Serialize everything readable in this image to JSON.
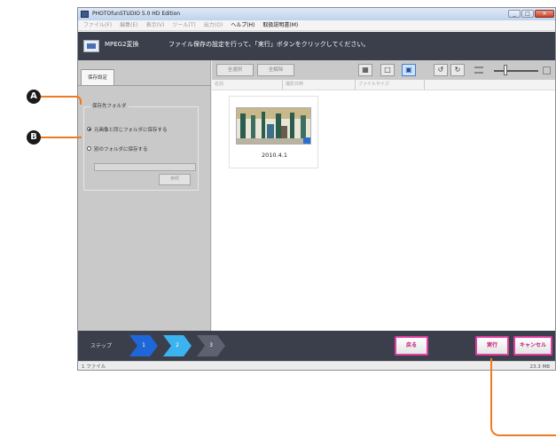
{
  "window": {
    "title": "PHOTOfunSTUDIO 5.0 HD Edition",
    "controls": [
      "_",
      "□",
      "✕"
    ]
  },
  "menu": {
    "items": [
      {
        "label": "ファイル(F)",
        "enabled": false
      },
      {
        "label": "編集(E)",
        "enabled": false
      },
      {
        "label": "表示(V)",
        "enabled": false
      },
      {
        "label": "ツール(T)",
        "enabled": false
      },
      {
        "label": "出力(O)",
        "enabled": false
      },
      {
        "label": "ヘルプ(H)",
        "enabled": true
      },
      {
        "label": "取扱説明書(M)",
        "enabled": true
      }
    ]
  },
  "header": {
    "title": "MPEG2変換",
    "message": "ファイル保存の設定を行って、「実行」ボタンをクリックしてください。"
  },
  "left_panel": {
    "tab_label": "保存設定",
    "group_label": "保存先フォルダ",
    "options": [
      {
        "label": "元画像と同じフォルダに保存する",
        "selected": true
      },
      {
        "label": "別のフォルダに保存する",
        "selected": false
      }
    ],
    "browse_label": "参照"
  },
  "toolbar": {
    "select_all": "全選択",
    "deselect_all": "全解除",
    "icons": [
      "view-mode-icon",
      "single-view-icon",
      "thumbnail-view-icon",
      "rotate-left-icon",
      "rotate-right-icon",
      "list-icon"
    ],
    "zoom_level": 0.22
  },
  "columns": [
    "名前",
    "撮影日時",
    "ファイルサイズ"
  ],
  "thumbnail": {
    "date": "2010.4.1",
    "colors": {
      "sky": "#c9b88a",
      "wall": "#e9e6d6",
      "pillar": "#2a5d4d",
      "people": "#3b6f8a"
    }
  },
  "steps": {
    "label": "ステップ",
    "items": [
      {
        "label": "1",
        "color": "#1f66d8"
      },
      {
        "label": "2",
        "color": "#3ab3ef"
      },
      {
        "label": "3",
        "color": "#5e6270"
      }
    ]
  },
  "actions": {
    "back": "戻る",
    "execute": "実行",
    "cancel": "キャンセル"
  },
  "status": {
    "count": "1 ファイル",
    "size": "23.3 MB"
  },
  "callouts": {
    "a": "A",
    "b": "B",
    "line_color": "#f07a1e"
  },
  "colors": {
    "header_bg": "#3b3f4c",
    "accent_pink": "#e03da0"
  }
}
